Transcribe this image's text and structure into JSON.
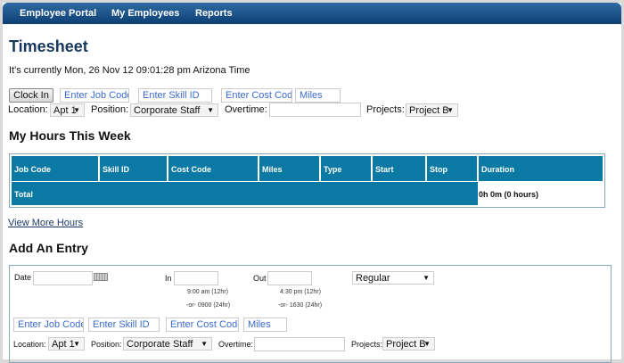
{
  "nav": {
    "items": [
      "Employee Portal",
      "My Employees",
      "Reports"
    ]
  },
  "page": {
    "title": "Timesheet",
    "current_time": "It's currently Mon, 26 Nov 12 09:01:28 pm Arizona Time"
  },
  "clock": {
    "button": "Clock In",
    "job_code_placeholder": "Enter Job Code",
    "skill_id_placeholder": "Enter Skill ID",
    "cost_code_placeholder": "Enter Cost Code",
    "miles_placeholder": "Miles",
    "location_label": "Location:",
    "location_value": "Apt 1",
    "position_label": "Position:",
    "position_value": "Corporate Staff",
    "overtime_label": "Overtime:",
    "overtime_value": "",
    "projects_label": "Projects:",
    "projects_value": "Project B"
  },
  "hours": {
    "title": "My Hours This Week",
    "columns": [
      "Job Code",
      "Skill ID",
      "Cost Code",
      "Miles",
      "Type",
      "Start",
      "Stop",
      "Duration"
    ],
    "total_label": "Total",
    "total_duration": "0h 0m (0 hours)",
    "view_more": "View More Hours"
  },
  "entry": {
    "title": "Add An Entry",
    "date_label": "Date",
    "date_value": "",
    "in_label": "In",
    "in_value": "",
    "out_label": "Out",
    "out_value": "",
    "type_value": "Regular",
    "in_hint_12": "9:00 am (12hr)",
    "in_hint_24": "-or- 0900 (24hr)",
    "out_hint_12": "4:30 pm (12hr)",
    "out_hint_24": "-or- 1630 (24hr)",
    "job_code_placeholder": "Enter Job Code",
    "skill_id_placeholder": "Enter Skill ID",
    "cost_code_placeholder": "Enter Cost Code",
    "miles_placeholder": "Miles",
    "location_label": "Location:",
    "location_value": "Apt 1",
    "position_label": "Position:",
    "position_value": "Corporate Staff",
    "overtime_label": "Overtime:",
    "overtime_value": "",
    "projects_label": "Projects:",
    "projects_value": "Project B"
  }
}
